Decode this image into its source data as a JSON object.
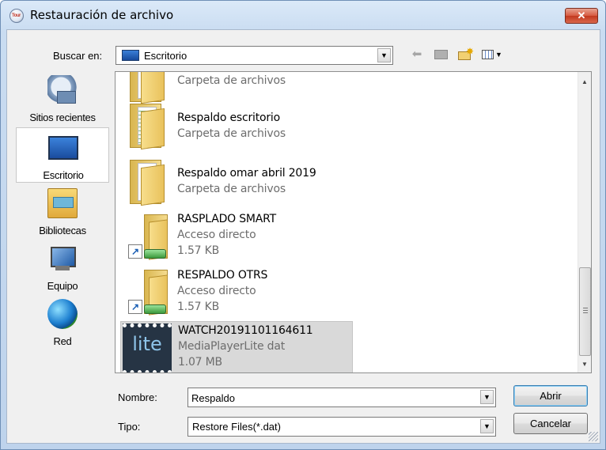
{
  "window": {
    "title": "Restauración de archivo",
    "close_symbol": "✕",
    "app_icon_text": "Tour"
  },
  "lookin": {
    "label": "Buscar en:",
    "value": "Escritorio"
  },
  "toolbar": {
    "back_icon": "arrow-left-icon",
    "up_icon": "up-folder-icon",
    "new_icon": "new-folder-icon",
    "view_icon": "view-menu-icon"
  },
  "places": [
    {
      "label": "Sitios recientes",
      "icon": "recent-places-icon"
    },
    {
      "label": "Escritorio",
      "icon": "desktop-icon",
      "selected": true
    },
    {
      "label": "Bibliotecas",
      "icon": "libraries-icon"
    },
    {
      "label": "Equipo",
      "icon": "computer-icon"
    },
    {
      "label": "Red",
      "icon": "network-icon"
    }
  ],
  "files": [
    {
      "name": "",
      "line1": "Carpeta de archivos"
    },
    {
      "name": "Respaldo escritorio",
      "line1": "Carpeta de archivos"
    },
    {
      "name": "Respaldo omar abril 2019",
      "line1": "Carpeta de archivos"
    },
    {
      "name": "RASPLADO SMART",
      "line1": "Acceso directo",
      "line2": "1.57 KB"
    },
    {
      "name": "RESPALDO OTRS",
      "line1": "Acceso directo",
      "line2": "1.57 KB"
    },
    {
      "name": "WATCH20191101164611",
      "line1": "MediaPlayerLite dat",
      "line2": "1.07 MB",
      "icon_text": "lite",
      "selected": true
    }
  ],
  "scrollbar": {
    "up": "▲",
    "down": "▼"
  },
  "form": {
    "name_label": "Nombre:",
    "name_value": "Respaldo",
    "type_label": "Tipo:",
    "type_value": "Restore Files(*.dat)",
    "arrow": "▼"
  },
  "buttons": {
    "open": "Abrir",
    "cancel": "Cancelar"
  }
}
